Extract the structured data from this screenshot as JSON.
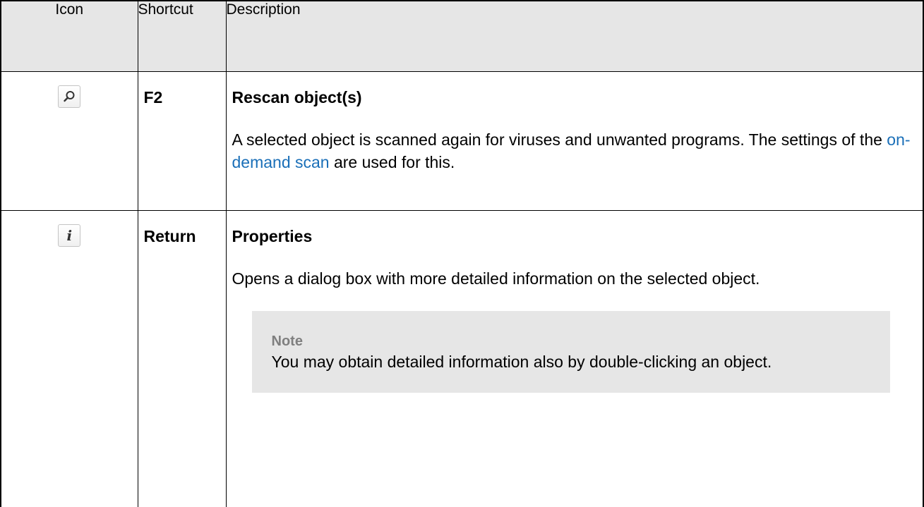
{
  "table": {
    "headers": {
      "icon": "Icon",
      "shortcut": "Shortcut",
      "description": "Description"
    },
    "rows": [
      {
        "icon": "search-icon",
        "shortcut": "F2",
        "title": "Rescan object(s)",
        "text_before_link": "A selected object is scanned again for viruses and unwanted programs. The settings of the ",
        "link": "on-demand scan",
        "text_after_link": " are used for this."
      },
      {
        "icon": "info-icon",
        "icon_glyph": "i",
        "shortcut": "Return",
        "title": "Properties",
        "text": "Opens a dialog box with more detailed information on the selected object.",
        "note": {
          "label": "Note",
          "text": "You may obtain detailed information also by double-clicking an object."
        }
      }
    ]
  },
  "colors": {
    "header_bg": "#e6e6e6",
    "note_bg": "#e6e6e6",
    "link": "#1a6fb8",
    "note_label": "#7f7f7f"
  }
}
